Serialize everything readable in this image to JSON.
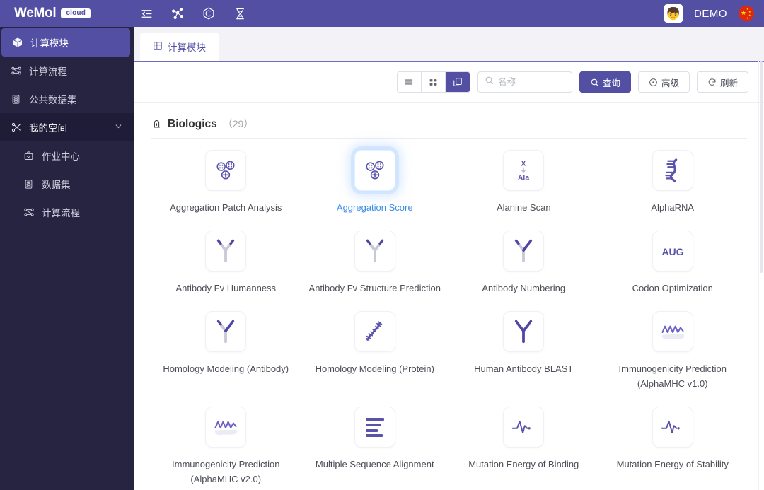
{
  "topbar": {
    "brand_name": "WeMol",
    "brand_badge": "cloud",
    "icons": [
      {
        "name": "collapse-menu-icon"
      },
      {
        "name": "molecule-icon"
      },
      {
        "name": "hexagon-icon"
      },
      {
        "name": "dna-helix-icon"
      }
    ],
    "user_name": "DEMO",
    "avatar_glyph": "👦",
    "flag_name": "china-flag-icon"
  },
  "sidebar": {
    "items": [
      {
        "label": "计算模块",
        "icon": "cube-icon",
        "state": "active",
        "key": "compute-modules"
      },
      {
        "label": "计算流程",
        "icon": "workflow-icon",
        "state": "normal",
        "key": "compute-workflow"
      },
      {
        "label": "公共数据集",
        "icon": "database-icon",
        "state": "normal",
        "key": "public-datasets"
      },
      {
        "label": "我的空间",
        "icon": "scissors-icon",
        "state": "group",
        "key": "my-space",
        "expanded": true
      },
      {
        "label": "作业中心",
        "icon": "briefcase-icon",
        "state": "sub",
        "key": "job-center"
      },
      {
        "label": "数据集",
        "icon": "database-icon",
        "state": "sub",
        "key": "datasets"
      },
      {
        "label": "计算流程",
        "icon": "workflow-icon",
        "state": "sub",
        "key": "workflows"
      }
    ]
  },
  "tabs": [
    {
      "label": "计算模块",
      "icon": "module-grid-icon",
      "active": true
    }
  ],
  "toolbar": {
    "views": [
      {
        "name": "list-view-button",
        "icon": "list-icon",
        "active": false
      },
      {
        "name": "grid-view-button",
        "icon": "grid-icon",
        "active": false
      },
      {
        "name": "card-view-button",
        "icon": "card-icon",
        "active": true
      }
    ],
    "search": {
      "value": "",
      "placeholder": "名称",
      "icon": "search-icon"
    },
    "query_label": "查询",
    "advanced_label": "高级",
    "refresh_label": "刷新"
  },
  "section": {
    "icon": "biologics-icon",
    "title": "Biologics",
    "count_open": "（",
    "count": "29",
    "count_text": "（29）"
  },
  "cards": [
    {
      "label": "Aggregation Patch Analysis",
      "icon": "aggregation-particles-icon",
      "hovered": false
    },
    {
      "label": "Aggregation Score",
      "icon": "aggregation-particles-icon",
      "hovered": true
    },
    {
      "label": "Alanine Scan",
      "icon": "alanine-scan-icon",
      "hovered": false
    },
    {
      "label": "AlphaRNA",
      "icon": "rna-strand-icon",
      "hovered": false
    },
    {
      "label": "Antibody Fv Humanness",
      "icon": "antibody-partial-icon",
      "hovered": false
    },
    {
      "label": "Antibody Fv Structure Prediction",
      "icon": "antibody-partial-icon",
      "hovered": false
    },
    {
      "label": "Antibody Numbering",
      "icon": "antibody-partial-icon",
      "hovered": false
    },
    {
      "label": "Codon Optimization",
      "icon": "codon-aug-icon",
      "hovered": false
    },
    {
      "label": "Homology Modeling (Antibody)",
      "icon": "antibody-partial-icon",
      "hovered": false
    },
    {
      "label": "Homology Modeling (Protein)",
      "icon": "protein-ribbon-icon",
      "hovered": false
    },
    {
      "label": "Human Antibody BLAST",
      "icon": "antibody-full-icon",
      "hovered": false
    },
    {
      "label": "Immunogenicity Prediction (AlphaMHC v1.0)",
      "icon": "peptide-wave-icon",
      "hovered": false
    },
    {
      "label": "Immunogenicity Prediction (AlphaMHC v2.0)",
      "icon": "peptide-wave-icon",
      "hovered": false
    },
    {
      "label": "Multiple Sequence Alignment",
      "icon": "alignment-bars-icon",
      "hovered": false
    },
    {
      "label": "Mutation Energy of Binding",
      "icon": "pulse-wave-icon",
      "hovered": false
    },
    {
      "label": "Mutation Energy of Stability",
      "icon": "pulse-wave-icon",
      "hovered": false
    }
  ],
  "colors": {
    "brand_purple": "#534fa3",
    "sidebar_dark": "#262441",
    "icon_purple": "#5a53ab",
    "hover_blue": "#3b8fe8"
  },
  "alanine": {
    "from": "X",
    "to": "Ala"
  },
  "codon": {
    "text": "AUG"
  }
}
